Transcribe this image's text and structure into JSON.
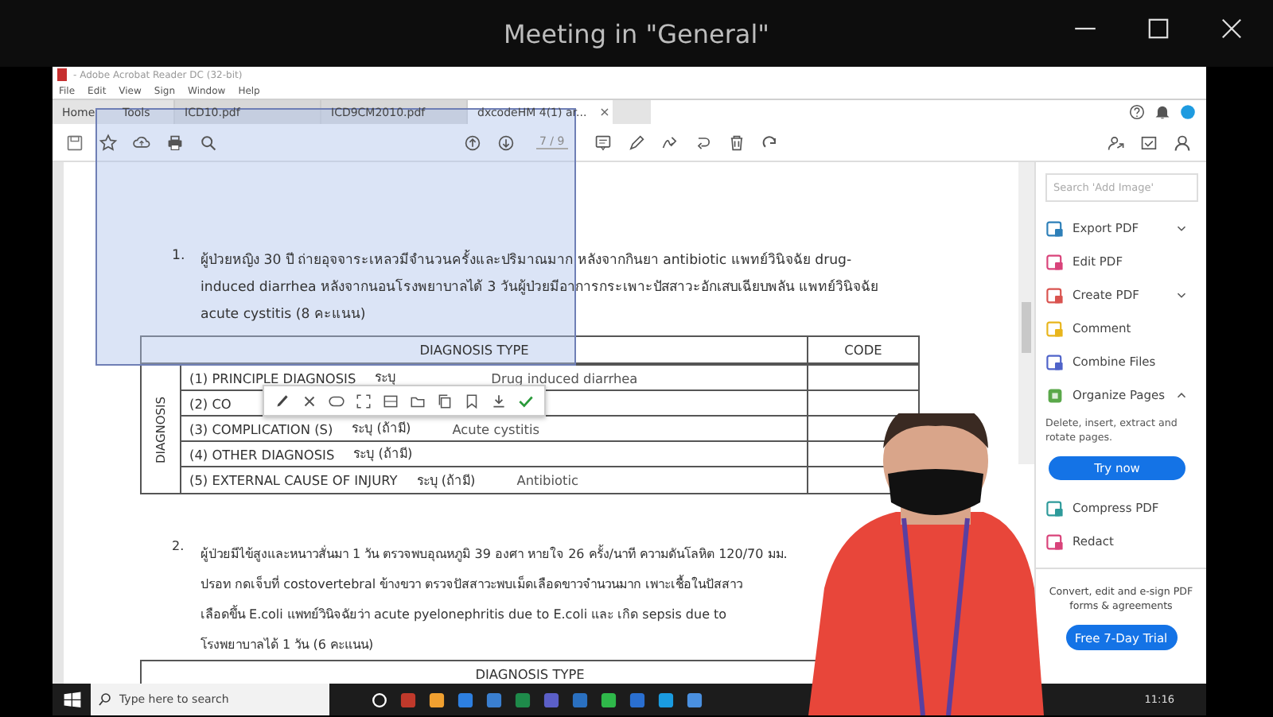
{
  "meeting": {
    "title": "Meeting in \"General\""
  },
  "acrobat": {
    "title": "- Adobe Acrobat Reader DC (32-bit)",
    "menu": [
      "File",
      "Edit",
      "View",
      "Sign",
      "Window",
      "Help"
    ],
    "tabs": [
      {
        "label": "Home",
        "kind": "nav",
        "selected": false
      },
      {
        "label": "Tools",
        "kind": "nav",
        "selected": false
      },
      {
        "label": "ICD10.pdf",
        "kind": "doc",
        "selected": false
      },
      {
        "label": "ICD9CM2010.pdf",
        "kind": "doc",
        "selected": false
      },
      {
        "label": "dxcodeHM 4(1) ar...",
        "kind": "doc",
        "selected": true,
        "close": "×"
      }
    ],
    "page_field": "7 / 9"
  },
  "document": {
    "question_1": {
      "number": "1.",
      "lines": [
        "ผู้ป่วยหญิง 30 ปี ถ่ายอุจจาระเหลวมีจำนวนครั้งและปริมาณมาก หลังจากกินยา antibiotic แพทย์วินิจฉัย drug-",
        "induced diarrhea หลังจากนอนโรงพยาบาลได้ 3 วันผู้ป่วยมีอาการกระเพาะปัสสาวะอักเสบเฉียบพลัน แพทย์วินิจฉัย",
        "acute cystitis (8 คะแนน)"
      ]
    },
    "table_1": {
      "header": "DIAGNOSIS TYPE",
      "code_header": "CODE",
      "side_label": "DIAGNOSIS",
      "rows": [
        {
          "label": "(1) PRINCIPLE DIAGNOSIS",
          "hint": "ระบุ",
          "answer": "Drug induced diarrhea"
        },
        {
          "label": "(2) CO"
        },
        {
          "label": "(3) COMPLICATION (S)",
          "hint": "ระบุ (ถ้ามี)",
          "answer": "Acute cystitis"
        },
        {
          "label": "(4) OTHER DIAGNOSIS",
          "hint": "ระบุ (ถ้ามี)"
        },
        {
          "label": "(5) EXTERNAL CAUSE OF INJURY",
          "hint": "ระบุ (ถ้ามี)",
          "answer": "Antibiotic"
        }
      ]
    },
    "question_2": {
      "number": "2.",
      "lines": [
        "ผู้ป่วยมีไข้สูงและหนาวสั่นมา 1 วัน ตรวจพบอุณหภูมิ 39 องศา หายใจ 26 ครั้ง/นาที ความดันโลหิต 120/70 มม.",
        "ปรอท กดเจ็บที่ costovertebral ข้างขวา ตรวจปัสสาวะพบเม็ดเลือดขาวจำนวนมาก เพาะเชื้อในปัสสาว",
        "เลือดขึ้น E.coli แพทย์วินิจฉัยว่า acute pyelonephritis due to E.coli และ เกิด sepsis due to",
        "โรงพยาบาลได้ 1 วัน (6 คะแนน)"
      ]
    },
    "table_2": {
      "header": "DIAGNOSIS TYPE"
    }
  },
  "tools_panel": {
    "search": {
      "placeholder": "Search 'Add Image'"
    },
    "items": [
      {
        "label": "Export PDF",
        "color": "#2d7fb8",
        "expanded": false
      },
      {
        "label": "Edit PDF",
        "color": "#d9437a"
      },
      {
        "label": "Create PDF",
        "color": "#d9534f",
        "expanded": false
      },
      {
        "label": "Comment",
        "color": "#e8b51c"
      },
      {
        "label": "Combine Files",
        "color": "#4f63c9"
      },
      {
        "label": "Organize Pages",
        "color": "#5aa84a",
        "expanded": true,
        "description": "Delete, insert, extract and rotate pages.",
        "button": "Try now"
      },
      {
        "label": "Compress PDF",
        "color": "#2d9a9a"
      },
      {
        "label": "Redact",
        "color": "#d9437a"
      }
    ],
    "promo": {
      "text": "Convert, edit and e-sign PDF forms & agreements",
      "button": "Free 7-Day Trial"
    }
  },
  "taskbar": {
    "search": {
      "placeholder": "Type here to search"
    },
    "time": "11:16"
  }
}
